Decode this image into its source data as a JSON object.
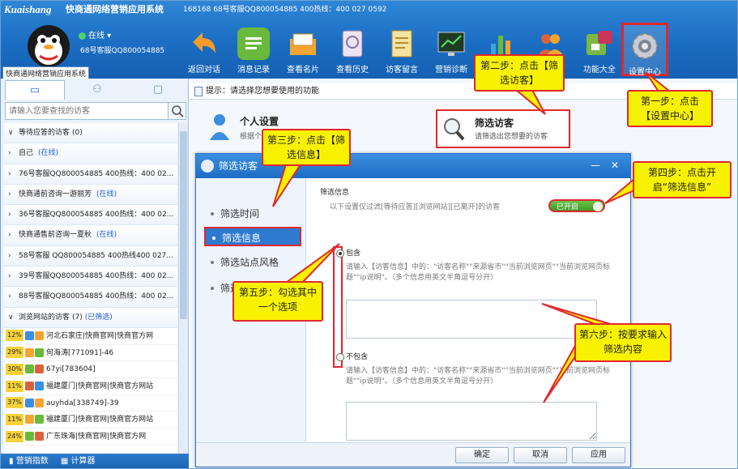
{
  "header": {
    "brand": "Kuaishang",
    "app_name": "快商通网络营销应用系统",
    "account_info": "168168 68号客服QQ800054885   400热线：400 027 0592",
    "status": "在线 ▾",
    "agent_name": "68号客服QQ800054885",
    "app_label": "快商通网络营销应用系统"
  },
  "toolbar": [
    {
      "label": "返回对话",
      "icon": "back-arrow-icon",
      "color": "#f29b2b"
    },
    {
      "label": "消息记录",
      "icon": "message-log-icon",
      "color": "#6ab93c"
    },
    {
      "label": "查看名片",
      "icon": "business-card-icon",
      "color": "#f2a531"
    },
    {
      "label": "查看历史",
      "icon": "history-icon",
      "color": "#b28ac8"
    },
    {
      "label": "访客留言",
      "icon": "visitor-message-icon",
      "color": "#e9cc6a"
    },
    {
      "label": "营销诊断",
      "icon": "marketing-diagnosis-icon",
      "color": "#2f7d3a"
    },
    {
      "label": "",
      "icon": "chart-icon",
      "color": "#3da3e0"
    },
    {
      "label": "",
      "icon": "users-icon",
      "color": "#d9623e"
    },
    {
      "label": "功能大全",
      "icon": "function-collection-icon",
      "color": "#7ab846"
    },
    {
      "label": "设置中心",
      "icon": "settings-gear-icon",
      "color": "#c8ccd2"
    }
  ],
  "left": {
    "search_placeholder": "请输入您要查找的访客",
    "groups": [
      {
        "label": "等待应答的访客",
        "count": "(0)",
        "online": "",
        "open": true
      },
      {
        "label": "自己",
        "count": "",
        "online": "(在线)",
        "open": false
      },
      {
        "label": "76号客服QQ800054885  400热线：400 02...",
        "count": "",
        "online": "",
        "open": false
      },
      {
        "label": "快商通前咨询一游丽芳",
        "count": "",
        "online": "(在线)",
        "open": false
      },
      {
        "label": "36号客服QQ800054885  400热线：400 02...",
        "count": "",
        "online": "",
        "open": false
      },
      {
        "label": "快商通售前咨询一夏秋",
        "count": "",
        "online": "(在线)",
        "open": false
      },
      {
        "label": "58号客服 QQ800054885  400热线400 027...",
        "count": "",
        "online": "",
        "open": false
      },
      {
        "label": "39号客服QQ800054885  400热线：400 02...",
        "count": "",
        "online": "",
        "open": false
      },
      {
        "label": "88号客服QQ800054885  400热线：400 02...",
        "count": "",
        "online": "",
        "open": false
      },
      {
        "label": "浏览网站的访客",
        "count": "(7)",
        "online": "(已筛选)",
        "open": true
      }
    ],
    "visitors": [
      {
        "pct": "12%",
        "text": "河北石家庄|快商官网|快商官方网"
      },
      {
        "pct": "29%",
        "text": "何海涛[771091]-46"
      },
      {
        "pct": "30%",
        "text": "67yi[783604]"
      },
      {
        "pct": "11%",
        "text": "福建厦门|快商官网|快商官方网站"
      },
      {
        "pct": "37%",
        "text": "auyhda[338749]-39"
      },
      {
        "pct": "11%",
        "text": "福建厦门|快商官网|快商官方网站"
      },
      {
        "pct": "24%",
        "text": "广东珠海|快商官网|快商官方网"
      }
    ],
    "footer": {
      "marketing_index": "营销指数",
      "calculator": "计算器"
    }
  },
  "right": {
    "hint": "提示：请选择您想要使用的功能",
    "personal_title": "个人设置",
    "personal_desc": "根据个...",
    "filter_title": "筛选访客",
    "filter_desc": "请筛选出您想要的访客"
  },
  "dialog": {
    "title": "筛选访客",
    "minimize": "—",
    "close": "✕",
    "nav": [
      "筛选时间",
      "筛选信息",
      "筛选站点风格",
      "筛选来源"
    ],
    "section_title": "筛选信息",
    "section_desc": "以下设置仅过滤[等待应答][浏览网站][已离开]的访客",
    "toggle_label": "已开启",
    "include_label": "包含",
    "exclude_label": "不包含",
    "include_desc": "请输入【访客信息】中的：\"访客名称\"\"来源省市\"\"当前浏览网页\"\"当前浏览网页标题\"\"ip说明\"。（多个信息用英文半角逗号分开）",
    "exclude_desc": "请输入【访客信息】中的：\"访客名称\"\"来源省市\"\"当前浏览网页\"\"当前浏览网页标题\"\"ip说明\"。（多个信息用英文半角逗号分开）",
    "include_value": "",
    "exclude_value": "",
    "buttons": {
      "ok": "确定",
      "cancel": "取消",
      "apply": "应用"
    }
  },
  "callouts": {
    "step1": "第一步：点击【设置中心】",
    "step2": "第二步：点击【筛选访客】",
    "step3": "第三步：点击【筛选信息】",
    "step4": "第四步：点击开启“筛选信息”",
    "step5": "第五步：勾选其中一个选项",
    "step6": "第六步：按要求输入筛选内容"
  },
  "colors": {
    "header_blue": "#1b6dc2",
    "highlight_red": "#e0282b",
    "callout_yellow": "#f8f100",
    "toggle_green": "#4faa32",
    "online_blue": "#1e5fd8",
    "pct_badge": "#f7d23a"
  }
}
